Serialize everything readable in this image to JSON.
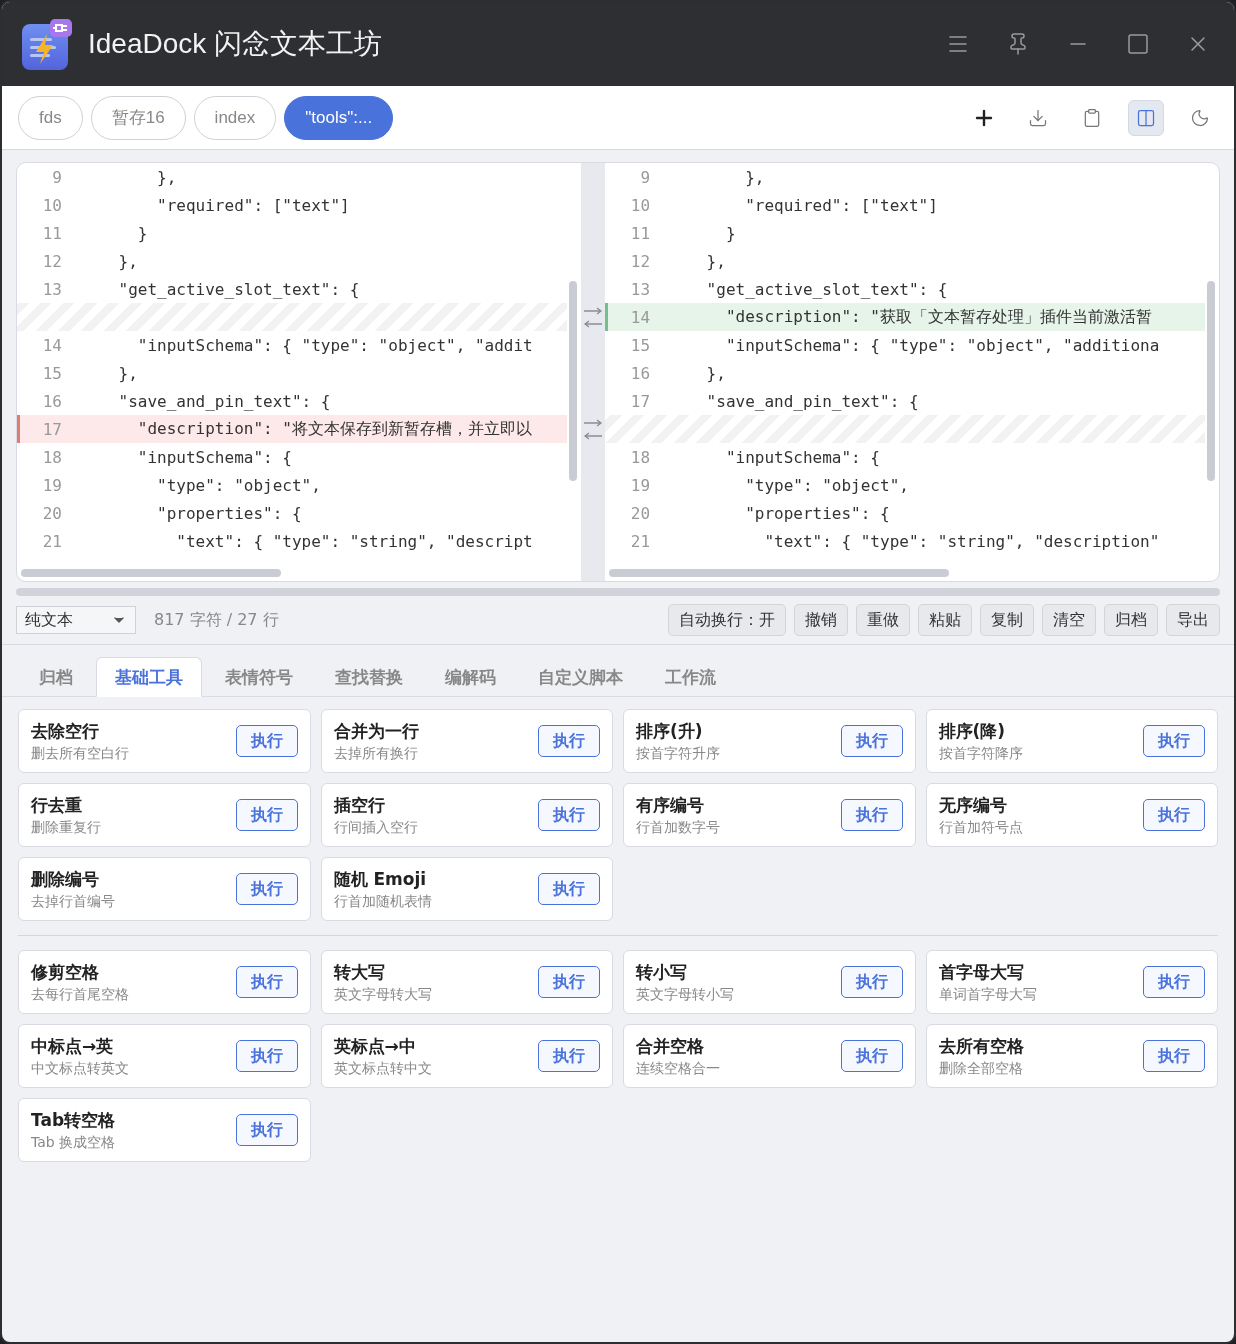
{
  "window": {
    "title": "IdeaDock 闪念文本工坊"
  },
  "slots": [
    {
      "label": "fds",
      "selected": false
    },
    {
      "label": "暂存16",
      "selected": false
    },
    {
      "label": "index",
      "selected": false
    },
    {
      "label": "\"tools\":...",
      "selected": true
    }
  ],
  "toolbar": [
    {
      "selected": false
    },
    {
      "selected": false
    },
    {
      "selected": false
    },
    {
      "selected": true
    },
    {
      "selected": false
    }
  ],
  "diff": {
    "left": [
      {
        "kind": "normal",
        "num": "9",
        "text": "        },"
      },
      {
        "kind": "normal",
        "num": "10",
        "text": "        \"required\": [\"text\"]"
      },
      {
        "kind": "normal",
        "num": "11",
        "text": "      }"
      },
      {
        "kind": "normal",
        "num": "12",
        "text": "    },"
      },
      {
        "kind": "normal",
        "num": "13",
        "text": "    \"get_active_slot_text\": {"
      },
      {
        "kind": "gap"
      },
      {
        "kind": "normal",
        "num": "14",
        "text": "      \"inputSchema\": { \"type\": \"object\", \"addit"
      },
      {
        "kind": "normal",
        "num": "15",
        "text": "    },"
      },
      {
        "kind": "normal",
        "num": "16",
        "text": "    \"save_and_pin_text\": {"
      },
      {
        "kind": "removed",
        "num": "17",
        "text": "      \"description\": \"将文本保存到新暂存槽，并立即以"
      },
      {
        "kind": "normal",
        "num": "18",
        "text": "      \"inputSchema\": {"
      },
      {
        "kind": "normal",
        "num": "19",
        "text": "        \"type\": \"object\","
      },
      {
        "kind": "normal",
        "num": "20",
        "text": "        \"properties\": {"
      },
      {
        "kind": "normal",
        "num": "21",
        "text": "          \"text\": { \"type\": \"string\", \"descript"
      }
    ],
    "right": [
      {
        "kind": "normal",
        "num": "9",
        "text": "        },"
      },
      {
        "kind": "normal",
        "num": "10",
        "text": "        \"required\": [\"text\"]"
      },
      {
        "kind": "normal",
        "num": "11",
        "text": "      }"
      },
      {
        "kind": "normal",
        "num": "12",
        "text": "    },"
      },
      {
        "kind": "normal",
        "num": "13",
        "text": "    \"get_active_slot_text\": {"
      },
      {
        "kind": "added",
        "num": "14",
        "text": "      \"description\": \"获取「文本暂存处理」插件当前激活暂"
      },
      {
        "kind": "normal",
        "num": "15",
        "text": "      \"inputSchema\": { \"type\": \"object\", \"additiona"
      },
      {
        "kind": "normal",
        "num": "16",
        "text": "    },"
      },
      {
        "kind": "normal",
        "num": "17",
        "text": "    \"save_and_pin_text\": {"
      },
      {
        "kind": "gap"
      },
      {
        "kind": "normal",
        "num": "18",
        "text": "      \"inputSchema\": {"
      },
      {
        "kind": "normal",
        "num": "19",
        "text": "        \"type\": \"object\","
      },
      {
        "kind": "normal",
        "num": "20",
        "text": "        \"properties\": {"
      },
      {
        "kind": "normal",
        "num": "21",
        "text": "          \"text\": { \"type\": \"string\", \"description\""
      }
    ]
  },
  "editor_bar": {
    "mode": "纯文本",
    "stats": "817 字符 / 27 行",
    "buttons": [
      "自动换行：开",
      "撤销",
      "重做",
      "粘贴",
      "复制",
      "清空",
      "归档",
      "导出"
    ]
  },
  "tool_tabs": [
    {
      "label": "归档",
      "selected": false
    },
    {
      "label": "基础工具",
      "selected": true
    },
    {
      "label": "表情符号",
      "selected": false
    },
    {
      "label": "查找替换",
      "selected": false
    },
    {
      "label": "编解码",
      "selected": false
    },
    {
      "label": "自定义脚本",
      "selected": false
    },
    {
      "label": "工作流",
      "selected": false
    }
  ],
  "tool_groups": [
    [
      {
        "title": "去除空行",
        "desc": "删去所有空白行",
        "action": "执行"
      },
      {
        "title": "合并为一行",
        "desc": "去掉所有换行",
        "action": "执行"
      },
      {
        "title": "排序(升)",
        "desc": "按首字符升序",
        "action": "执行"
      },
      {
        "title": "排序(降)",
        "desc": "按首字符降序",
        "action": "执行"
      },
      {
        "title": "行去重",
        "desc": "删除重复行",
        "action": "执行"
      },
      {
        "title": "插空行",
        "desc": "行间插入空行",
        "action": "执行"
      },
      {
        "title": "有序编号",
        "desc": "行首加数字号",
        "action": "执行"
      },
      {
        "title": "无序编号",
        "desc": "行首加符号点",
        "action": "执行"
      },
      {
        "title": "删除编号",
        "desc": "去掉行首编号",
        "action": "执行"
      },
      {
        "title": "随机 Emoji",
        "desc": "行首加随机表情",
        "action": "执行"
      }
    ],
    [
      {
        "title": "修剪空格",
        "desc": "去每行首尾空格",
        "action": "执行"
      },
      {
        "title": "转大写",
        "desc": "英文字母转大写",
        "action": "执行"
      },
      {
        "title": "转小写",
        "desc": "英文字母转小写",
        "action": "执行"
      },
      {
        "title": "首字母大写",
        "desc": "单词首字母大写",
        "action": "执行"
      },
      {
        "title": "中标点→英",
        "desc": "中文标点转英文",
        "action": "执行"
      },
      {
        "title": "英标点→中",
        "desc": "英文标点转中文",
        "action": "执行"
      },
      {
        "title": "合并空格",
        "desc": "连续空格合一",
        "action": "执行"
      },
      {
        "title": "去所有空格",
        "desc": "删除全部空格",
        "action": "执行"
      },
      {
        "title": "Tab转空格",
        "desc": "Tab 换成空格",
        "action": "执行"
      }
    ]
  ]
}
